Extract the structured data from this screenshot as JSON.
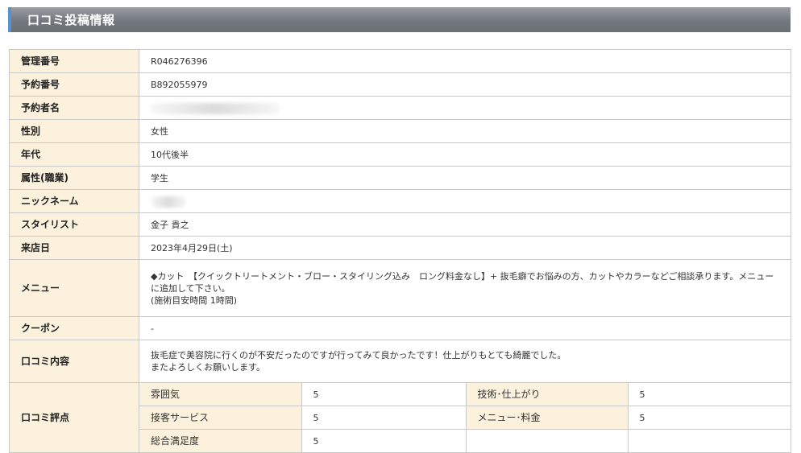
{
  "header": {
    "title": "口コミ投稿情報"
  },
  "fields": [
    {
      "label": "管理番号",
      "value": "R046276396"
    },
    {
      "label": "予約番号",
      "value": "B892055979"
    },
    {
      "label": "予約者名",
      "value": ""
    },
    {
      "label": "性別",
      "value": "女性"
    },
    {
      "label": "年代",
      "value": "10代後半"
    },
    {
      "label": "属性(職業)",
      "value": "学生"
    },
    {
      "label": "ニックネーム",
      "value": ""
    },
    {
      "label": "スタイリスト",
      "value": "金子 貴之"
    },
    {
      "label": "来店日",
      "value": "2023年4月29日(土)"
    }
  ],
  "menu": {
    "label": "メニュー",
    "line1": "◆カット　【クイックトリートメント・ブロー・スタイリング込み　ロング料金なし】+ 抜毛癖でお悩みの方、カットやカラーなどご相談承ります。メニューに追加して下さい。",
    "line2": "(施術目安時間 1時間)"
  },
  "coupon": {
    "label": "クーポン",
    "value": "-"
  },
  "review": {
    "label": "口コミ内容",
    "line1": "抜毛症で美容院に行くのが不安だったのですが行ってみて良かったです！仕上がりもとても綺麗でした。",
    "line2": "またよろしくお願いします。"
  },
  "ratings": {
    "label": "口コミ評点",
    "items": [
      {
        "label": "雰囲気",
        "value": "5"
      },
      {
        "label": "技術･仕上がり",
        "value": "5"
      },
      {
        "label": "接客サービス",
        "value": "5"
      },
      {
        "label": "メニュー･料金",
        "value": "5"
      },
      {
        "label": "総合満足度",
        "value": "5"
      }
    ]
  },
  "colors": {
    "label_bg": "#fbf1dc",
    "header_bg": "#777c82",
    "accent": "#5a8fd0",
    "border": "#c8c8c8"
  }
}
